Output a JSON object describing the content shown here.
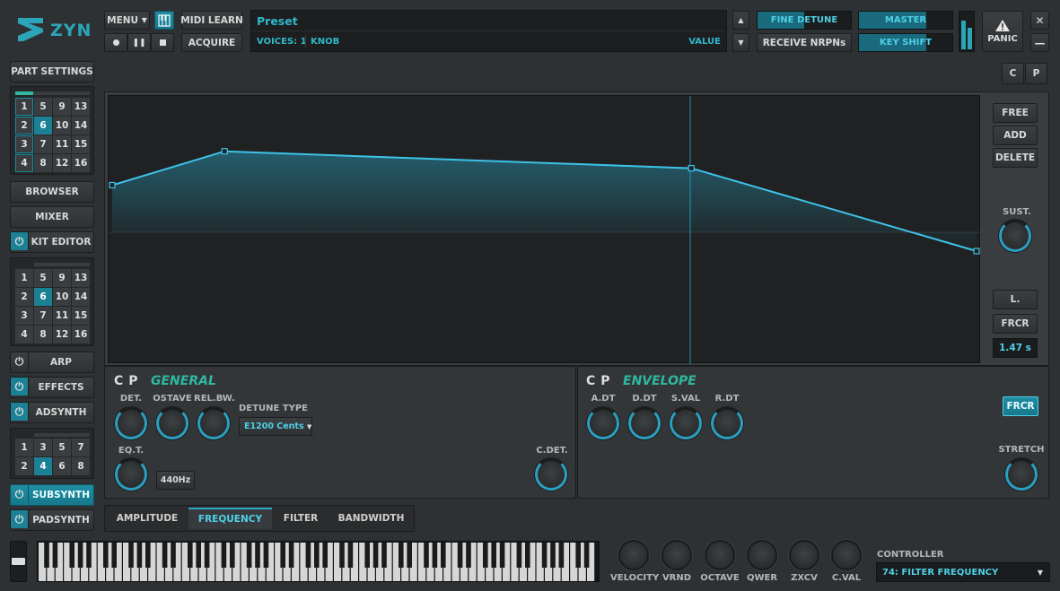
{
  "app": {
    "logo": "ZYN"
  },
  "top": {
    "menu": "MENU",
    "midi_learn": "MIDI LEARN",
    "acquire": "ACQUIRE",
    "preset_name": "Preset",
    "voices": "VOICES: 1",
    "knob_name": "KNOB",
    "value_label": "VALUE",
    "fine_detune": "FINE DETUNE",
    "receive_nrpns": "RECEIVE NRPNs",
    "master": "MASTER",
    "key_shift": "KEY SHIFT",
    "panic": "PANIC",
    "c_btn": "C",
    "p_btn": "P"
  },
  "sidebar": {
    "part_settings": "PART SETTINGS",
    "parts_grid": [
      [
        "1",
        "5",
        "9",
        "13"
      ],
      [
        "2",
        "6",
        "10",
        "14"
      ],
      [
        "3",
        "7",
        "11",
        "15"
      ],
      [
        "4",
        "8",
        "12",
        "16"
      ]
    ],
    "browser": "BROWSER",
    "mixer": "MIXER",
    "kit_editor": "KIT EDITOR",
    "kit_grid": [
      [
        "1",
        "5",
        "9",
        "13"
      ],
      [
        "2",
        "6",
        "10",
        "14"
      ],
      [
        "3",
        "7",
        "11",
        "15"
      ],
      [
        "4",
        "8",
        "12",
        "16"
      ]
    ],
    "arp": "ARP",
    "effects": "EFFECTS",
    "adsynth": "ADSYNTH",
    "voice_grid": [
      [
        "1",
        "3",
        "5",
        "7"
      ],
      [
        "2",
        "4",
        "6",
        "8"
      ]
    ],
    "subsynth": "SUBSYNTH",
    "padsynth": "PADSYNTH"
  },
  "envelope_editor": {
    "free": "FREE",
    "add": "ADD",
    "delete": "DELETE",
    "sust": "SUST.",
    "l": "L.",
    "frcr": "FRCR",
    "time": "1.47 s",
    "points": [
      {
        "t": 0,
        "v": 0.5
      },
      {
        "t": 0.13,
        "v": 0.86
      },
      {
        "t": 0.67,
        "v": 0.68
      },
      {
        "t": 1,
        "v": -0.2
      }
    ]
  },
  "general": {
    "c": "C",
    "p": "P",
    "title": "GENERAL",
    "det": "DET.",
    "ostave": "OSTAVE",
    "relbw": "REL.BW.",
    "detune_type_label": "DETUNE TYPE",
    "detune_type": "E1200 Cents",
    "eqt": "EQ.T.",
    "freq": "440Hz",
    "cdet": "C.DET."
  },
  "envelope": {
    "c": "C",
    "p": "P",
    "title": "ENVELOPE",
    "adt": "A.DT",
    "ddt": "D.DT",
    "sval": "S.VAL",
    "rdt": "R.DT",
    "frcr": "FRCR",
    "stretch": "STRETCH"
  },
  "tabs": [
    "AMPLITUDE",
    "FREQUENCY",
    "FILTER",
    "BANDWIDTH"
  ],
  "bottom": {
    "knobs": [
      "VELOCITY",
      "VRND",
      "OCTAVE",
      "QWER",
      "ZXCV",
      "C.VAL"
    ],
    "controller_label": "CONTROLLER",
    "controller_value": "74: FILTER FREQUENCY"
  },
  "colors": {
    "accent": "#2a9fc0",
    "teal": "#1d8196",
    "title": "#2fb8a0"
  }
}
